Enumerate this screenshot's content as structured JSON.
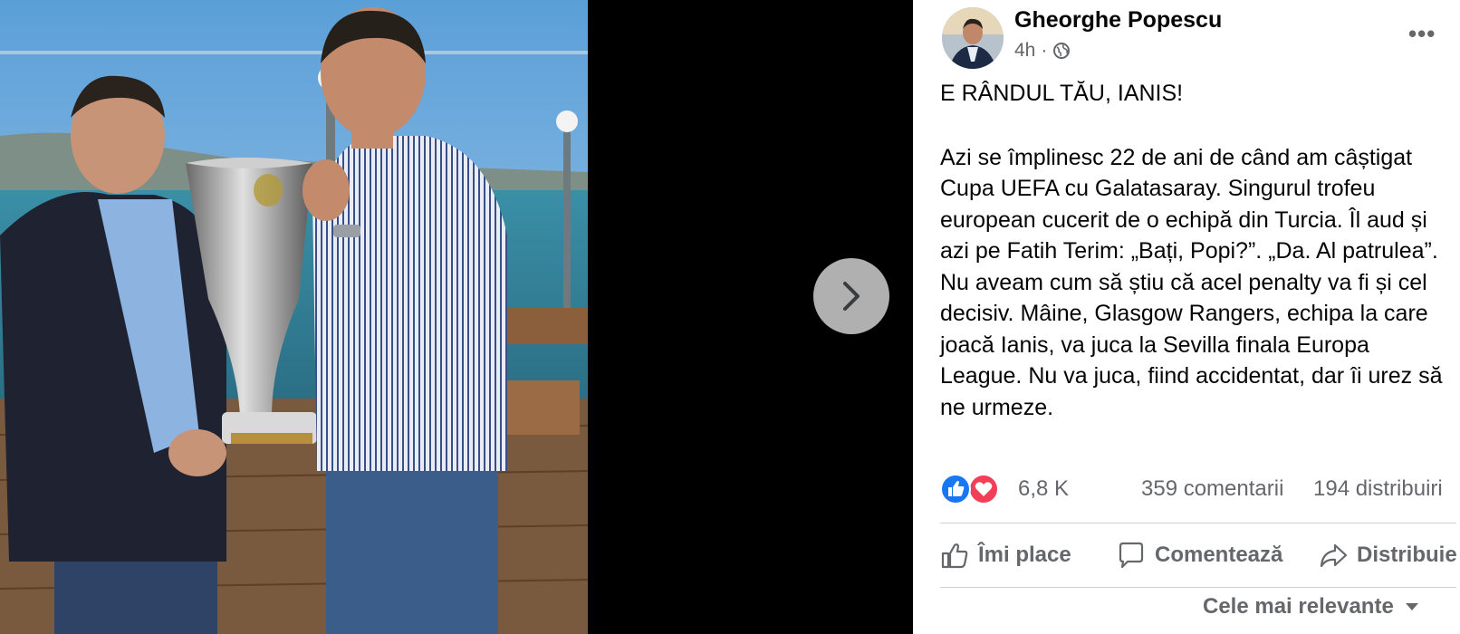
{
  "post": {
    "author": "Gheorghe Popescu",
    "time": "4h",
    "separator": "·",
    "audience_icon": "globe-icon",
    "more_label": "•••",
    "text": {
      "title": "E RÂNDUL TĂU, IANIS!",
      "body": "Azi se împlinesc 22 de ani de când am câștigat Cupa UEFA cu Galatasaray. Singurul trofeu european cucerit de o echipă din Turcia. Îl aud și azi pe Fatih Terim: „Bați, Popi?”. „Da. Al patrulea”. Nu aveam cum să știu că acel penalty va fi și cel decisiv. Mâine, Glasgow Rangers, echipa la care joacă Ianis, va juca la Sevilla finala Europa League. Nu va juca, fiind accidentat, dar îi urez să ne urmeze."
    }
  },
  "stats": {
    "reactions": "6,8 K",
    "comments": "359 comentarii",
    "shares": "194 distribuiri",
    "reaction_icons": [
      "like-icon",
      "love-icon"
    ]
  },
  "actions": {
    "like": "Îmi place",
    "comment": "Comentează",
    "share": "Distribuie"
  },
  "comments_sort": {
    "label": "Cele mai relevante",
    "icon": "caret-down-icon"
  },
  "viewer": {
    "next_icon": "chevron-right-icon"
  },
  "colors": {
    "like_blue": "#1877f2",
    "love_red": "#f33e58",
    "secondary_text": "#65676b",
    "divider": "#ced0d4"
  }
}
